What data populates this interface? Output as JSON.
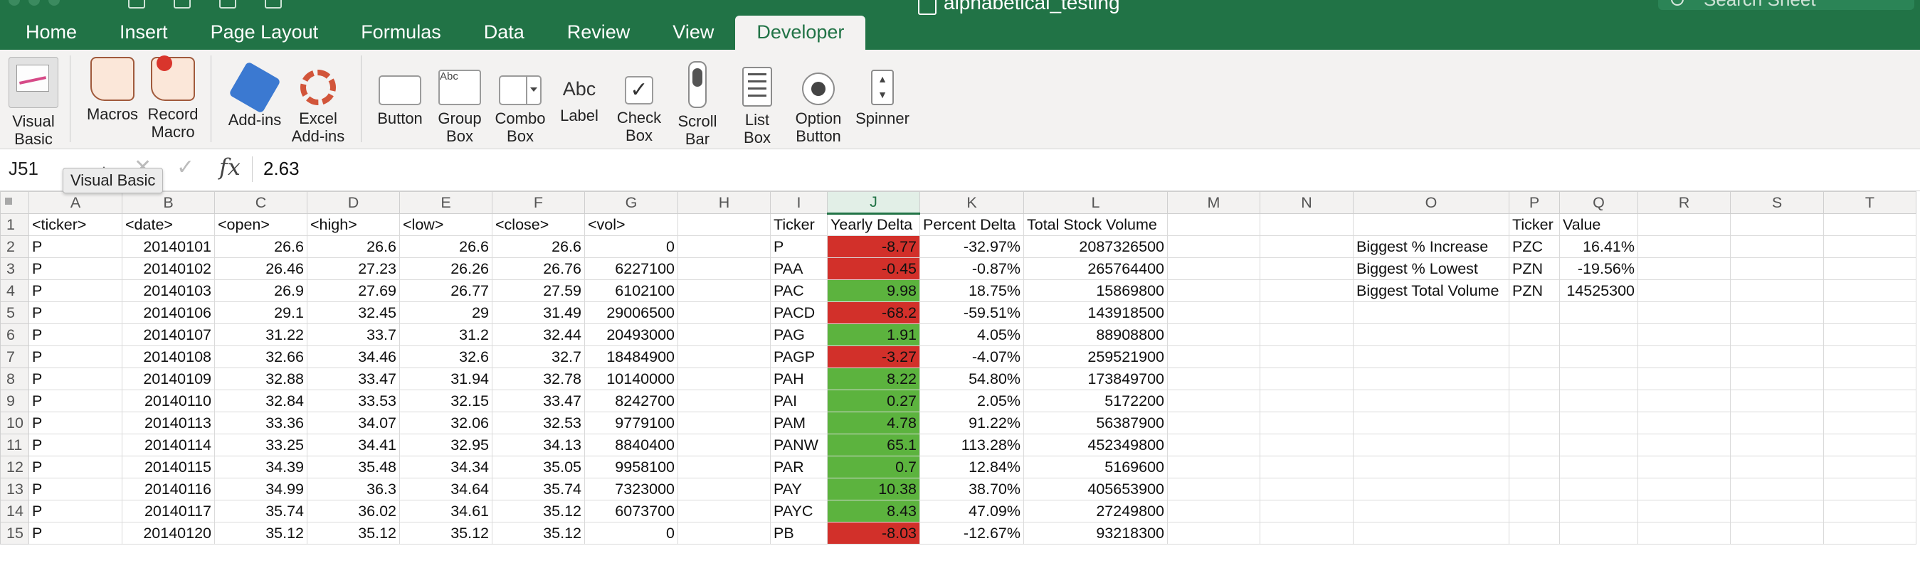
{
  "title_bar": {
    "document_title": "alphabetical_testing",
    "search_placeholder": "Search Sheet"
  },
  "tabs": [
    "Home",
    "Insert",
    "Page Layout",
    "Formulas",
    "Data",
    "Review",
    "View",
    "Developer"
  ],
  "active_tab": "Developer",
  "ribbon": {
    "visual_basic": [
      "Visual",
      "Basic"
    ],
    "macros": "Macros",
    "record_macro": [
      "Record",
      "Macro"
    ],
    "add_ins": "Add-ins",
    "excel_add_ins": [
      "Excel",
      "Add-ins"
    ],
    "button": "Button",
    "group_box": [
      "Group",
      "Box"
    ],
    "group_box_icon_text": "Abc",
    "combo_box": [
      "Combo",
      "Box"
    ],
    "label": "Label",
    "label_icon_text": "Abc",
    "check_box": [
      "Check",
      "Box"
    ],
    "scroll_bar": [
      "Scroll",
      "Bar"
    ],
    "list_box": [
      "List",
      "Box"
    ],
    "option_button": [
      "Option",
      "Button"
    ],
    "spinner": "Spinner"
  },
  "formula_bar": {
    "name_box": "J51",
    "fx": "fx",
    "value": "2.63"
  },
  "tooltip": "Visual Basic",
  "columns": [
    "A",
    "B",
    "C",
    "D",
    "E",
    "F",
    "G",
    "H",
    "I",
    "J",
    "K",
    "L",
    "M",
    "N",
    "O",
    "P",
    "Q",
    "R",
    "S",
    "T"
  ],
  "selected_column": "J",
  "rows": [
    {
      "n": "1",
      "A": "<ticker>",
      "B": "<date>",
      "C": "<open>",
      "D": "<high>",
      "E": "<low>",
      "F": "<close>",
      "G": "<vol>",
      "I": "Ticker",
      "J": "Yearly Delta",
      "K": "Percent Delta",
      "L": "Total Stock Volume",
      "O": "",
      "P": "Ticker",
      "Q": "Value"
    },
    {
      "n": "2",
      "A": "P",
      "B": "20140101",
      "C": "26.6",
      "D": "26.6",
      "E": "26.6",
      "F": "26.6",
      "G": "0",
      "I": "P",
      "J": "-8.77",
      "K": "-32.97%",
      "L": "2087326500",
      "O": "Biggest % Increase",
      "P": "PZC",
      "Q": "16.41%"
    },
    {
      "n": "3",
      "A": "P",
      "B": "20140102",
      "C": "26.46",
      "D": "27.23",
      "E": "26.26",
      "F": "26.76",
      "G": "6227100",
      "I": "PAA",
      "J": "-0.45",
      "K": "-0.87%",
      "L": "265764400",
      "O": "Biggest % Lowest",
      "P": "PZN",
      "Q": "-19.56%"
    },
    {
      "n": "4",
      "A": "P",
      "B": "20140103",
      "C": "26.9",
      "D": "27.69",
      "E": "26.77",
      "F": "27.59",
      "G": "6102100",
      "I": "PAC",
      "J": "9.98",
      "K": "18.75%",
      "L": "15869800",
      "O": "Biggest Total Volume",
      "P": "PZN",
      "Q": "14525300"
    },
    {
      "n": "5",
      "A": "P",
      "B": "20140106",
      "C": "29.1",
      "D": "32.45",
      "E": "29",
      "F": "31.49",
      "G": "29006500",
      "I": "PACD",
      "J": "-68.2",
      "K": "-59.51%",
      "L": "143918500"
    },
    {
      "n": "6",
      "A": "P",
      "B": "20140107",
      "C": "31.22",
      "D": "33.7",
      "E": "31.2",
      "F": "32.44",
      "G": "20493000",
      "I": "PAG",
      "J": "1.91",
      "K": "4.05%",
      "L": "88908800"
    },
    {
      "n": "7",
      "A": "P",
      "B": "20140108",
      "C": "32.66",
      "D": "34.46",
      "E": "32.6",
      "F": "32.7",
      "G": "18484900",
      "I": "PAGP",
      "J": "-3.27",
      "K": "-4.07%",
      "L": "259521900"
    },
    {
      "n": "8",
      "A": "P",
      "B": "20140109",
      "C": "32.88",
      "D": "33.47",
      "E": "31.94",
      "F": "32.78",
      "G": "10140000",
      "I": "PAH",
      "J": "8.22",
      "K": "54.80%",
      "L": "173849700"
    },
    {
      "n": "9",
      "A": "P",
      "B": "20140110",
      "C": "32.84",
      "D": "33.53",
      "E": "32.15",
      "F": "33.47",
      "G": "8242700",
      "I": "PAI",
      "J": "0.27",
      "K": "2.05%",
      "L": "5172200"
    },
    {
      "n": "10",
      "A": "P",
      "B": "20140113",
      "C": "33.36",
      "D": "34.07",
      "E": "32.06",
      "F": "32.53",
      "G": "9779100",
      "I": "PAM",
      "J": "4.78",
      "K": "91.22%",
      "L": "56387900"
    },
    {
      "n": "11",
      "A": "P",
      "B": "20140114",
      "C": "33.25",
      "D": "34.41",
      "E": "32.95",
      "F": "34.13",
      "G": "8840400",
      "I": "PANW",
      "J": "65.1",
      "K": "113.28%",
      "L": "452349800"
    },
    {
      "n": "12",
      "A": "P",
      "B": "20140115",
      "C": "34.39",
      "D": "35.48",
      "E": "34.34",
      "F": "35.05",
      "G": "9958100",
      "I": "PAR",
      "J": "0.7",
      "K": "12.84%",
      "L": "5169600"
    },
    {
      "n": "13",
      "A": "P",
      "B": "20140116",
      "C": "34.99",
      "D": "36.3",
      "E": "34.64",
      "F": "35.74",
      "G": "7323000",
      "I": "PAY",
      "J": "10.38",
      "K": "38.70%",
      "L": "405653900"
    },
    {
      "n": "14",
      "A": "P",
      "B": "20140117",
      "C": "35.74",
      "D": "36.02",
      "E": "34.61",
      "F": "35.12",
      "G": "6073700",
      "I": "PAYC",
      "J": "8.43",
      "K": "47.09%",
      "L": "27249800"
    },
    {
      "n": "15",
      "A": "P",
      "B": "20140120",
      "C": "35.12",
      "D": "35.12",
      "E": "35.12",
      "F": "35.12",
      "G": "0",
      "I": "PB",
      "J": "-8.03",
      "K": "-12.67%",
      "L": "93218300"
    }
  ],
  "colors": {
    "accent": "#217346",
    "positive_fill": "#5cb33e",
    "negative_fill": "#d2302a"
  }
}
